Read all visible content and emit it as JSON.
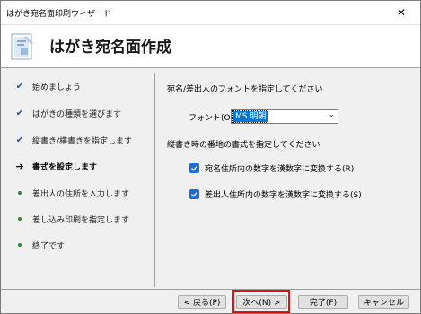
{
  "window": {
    "title": "はがき宛名面印刷ウィザード",
    "close_glyph": "✕"
  },
  "header": {
    "heading": "はがき宛名面作成",
    "icon": "postcard-wizard-icon"
  },
  "sidebar": {
    "steps": [
      {
        "label": "始めましょう",
        "state": "done"
      },
      {
        "label": "はがきの種類を選びます",
        "state": "done"
      },
      {
        "label": "縦書き/横書きを指定します",
        "state": "done"
      },
      {
        "label": "書式を設定します",
        "state": "current"
      },
      {
        "label": "差出人の住所を入力します",
        "state": "pending"
      },
      {
        "label": "差し込み印刷を指定します",
        "state": "pending"
      },
      {
        "label": "終了です",
        "state": "pending"
      }
    ],
    "check_glyph": "✔",
    "arrow_glyph": "➔"
  },
  "content": {
    "font_section_label": "宛名/差出人のフォントを指定してください",
    "font_field_label": "フォント(O):",
    "font_value": "MS 明朝",
    "number_section_label": "縦書き時の番地の書式を指定してください",
    "checkboxes": [
      {
        "label": "宛名住所内の数字を漢数字に変換する(R)",
        "checked": true
      },
      {
        "label": "差出人住所内の数字を漢数字に変換する(S)",
        "checked": true
      }
    ]
  },
  "buttons": {
    "back": "< 戻る(P)",
    "next": "次へ(N) >",
    "finish": "完了(F)",
    "cancel": "キャンセル"
  },
  "colors": {
    "accent": "#1a6fd4",
    "highlight": "#d01818"
  }
}
